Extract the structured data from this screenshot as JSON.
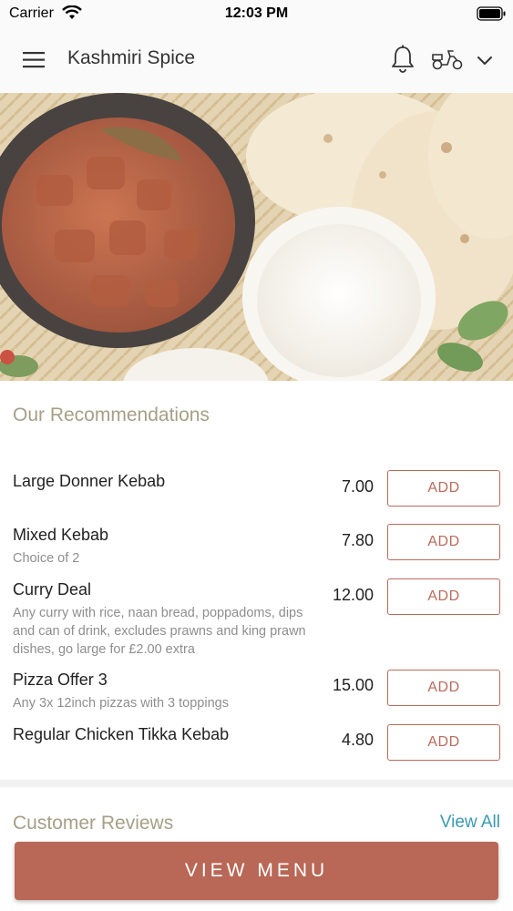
{
  "status_bar": {
    "carrier": "Carrier",
    "time": "12:03 PM"
  },
  "header": {
    "title": "Kashmiri Spice",
    "icons": [
      "hamburger-menu-icon",
      "bell-icon",
      "scooter-icon",
      "chevron-down-icon"
    ]
  },
  "recommendations": {
    "title": "Our Recommendations",
    "add_label": "ADD",
    "items": [
      {
        "name": "Large Donner Kebab",
        "description": "",
        "price": "7.00"
      },
      {
        "name": "Mixed Kebab",
        "description": "Choice of 2",
        "price": "7.80"
      },
      {
        "name": "Curry Deal",
        "description": "Any curry with rice, naan bread, poppadoms, dips and can of drink, excludes prawns and king prawn dishes, go large for £2.00 extra",
        "price": "12.00"
      },
      {
        "name": "Pizza Offer 3",
        "description": "Any 3x 12inch pizzas with 3 toppings",
        "price": "15.00"
      },
      {
        "name": "Regular Chicken Tikka Kebab",
        "description": "",
        "price": "4.80"
      }
    ]
  },
  "reviews": {
    "title": "Customer Reviews",
    "view_all": "View All"
  },
  "cta": {
    "label": "VIEW MENU"
  },
  "colors": {
    "accent": "#b96756",
    "section_title": "#a69f86",
    "link": "#3a9ab0"
  }
}
